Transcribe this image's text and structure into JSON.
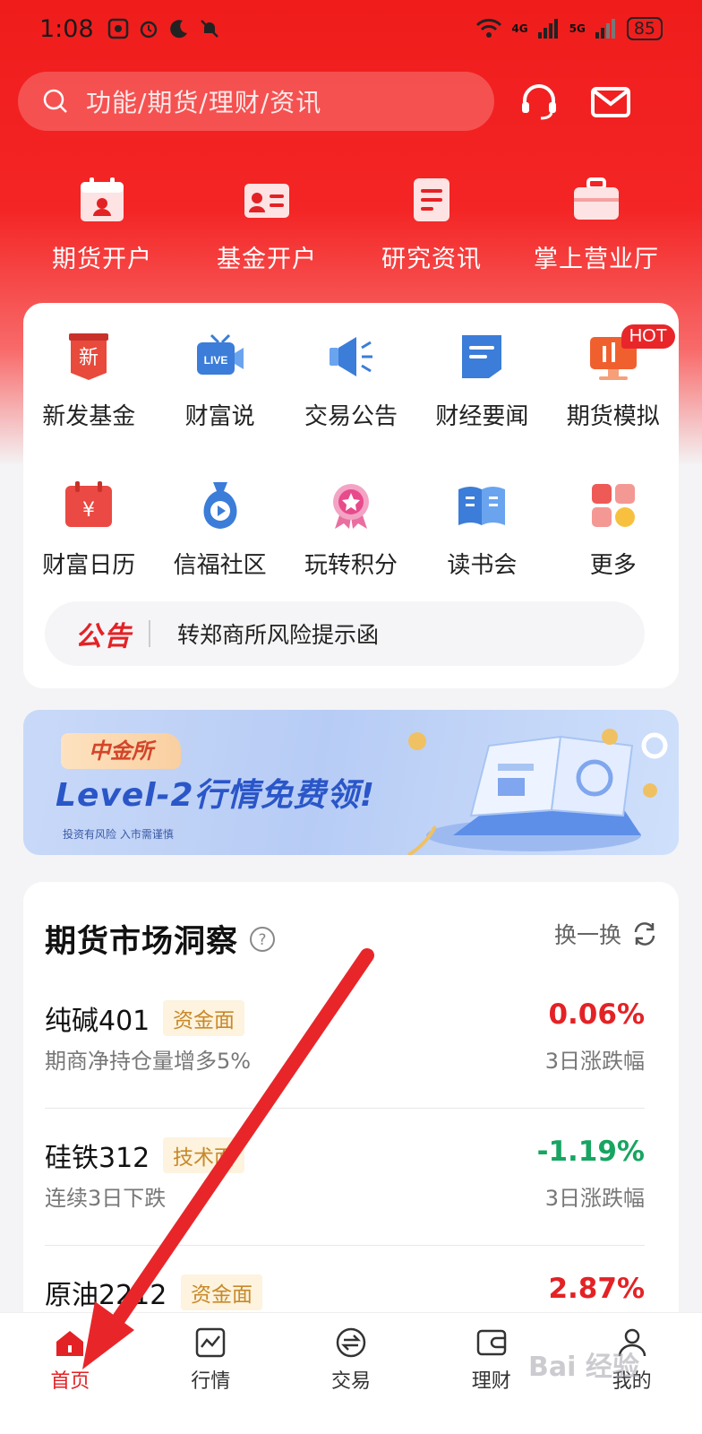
{
  "status_bar": {
    "time": "1:08",
    "battery": "85",
    "signal_labels": [
      "4G",
      "5G"
    ]
  },
  "search": {
    "placeholder": "功能/期货/理财/资讯"
  },
  "quick_actions": [
    {
      "label": "期货开户",
      "icon": "id-calendar-icon"
    },
    {
      "label": "基金开户",
      "icon": "id-card-icon"
    },
    {
      "label": "研究资讯",
      "icon": "document-icon"
    },
    {
      "label": "掌上营业厅",
      "icon": "briefcase-icon"
    }
  ],
  "menu": {
    "row1": [
      {
        "label": "新发基金",
        "icon": "new-fund-icon",
        "icon_text": "新"
      },
      {
        "label": "财富说",
        "icon": "live-tv-icon",
        "icon_text": "LIVE"
      },
      {
        "label": "交易公告",
        "icon": "megaphone-icon"
      },
      {
        "label": "财经要闻",
        "icon": "news-icon"
      },
      {
        "label": "期货模拟",
        "icon": "simulation-icon",
        "badge": "HOT"
      }
    ],
    "row2": [
      {
        "label": "财富日历",
        "icon": "yuan-calendar-icon",
        "icon_text": "¥"
      },
      {
        "label": "信福社区",
        "icon": "community-play-icon"
      },
      {
        "label": "玩转积分",
        "icon": "points-medal-icon"
      },
      {
        "label": "读书会",
        "icon": "book-icon"
      },
      {
        "label": "更多",
        "icon": "more-grid-icon"
      }
    ]
  },
  "notice": {
    "tag": "公告",
    "text": "转郑商所风险提示函"
  },
  "banner": {
    "tag": "中金所",
    "title": "Level-2行情免费领!",
    "note": "投资有风险 入市需谨慎"
  },
  "market": {
    "title": "期货市场洞察",
    "refresh_label": "换一换",
    "rows": [
      {
        "name": "纯碱401",
        "tag": "资金面",
        "desc": "期商净持仓量增多5%",
        "change": "0.06%",
        "sub": "3日涨跌幅",
        "direction": "up"
      },
      {
        "name": "硅铁312",
        "tag": "技术面",
        "desc": "连续3日下跌",
        "change": "-1.19%",
        "sub": "3日涨跌幅",
        "direction": "down"
      },
      {
        "name": "原油2212",
        "tag": "资金面",
        "desc": "",
        "change": "2.87%",
        "sub": "",
        "direction": "up"
      }
    ]
  },
  "tabbar": [
    {
      "label": "首页",
      "icon": "home-icon",
      "active": true
    },
    {
      "label": "行情",
      "icon": "chart-icon",
      "active": false
    },
    {
      "label": "交易",
      "icon": "exchange-icon",
      "active": false
    },
    {
      "label": "理财",
      "icon": "wallet-icon",
      "active": false
    },
    {
      "label": "我的",
      "icon": "user-icon",
      "active": false
    }
  ],
  "colors": {
    "brand_red": "#f01c1c",
    "up": "#e32225",
    "down": "#17a561",
    "tag_bg": "#fdf3de"
  },
  "watermark": "Bai 经验"
}
